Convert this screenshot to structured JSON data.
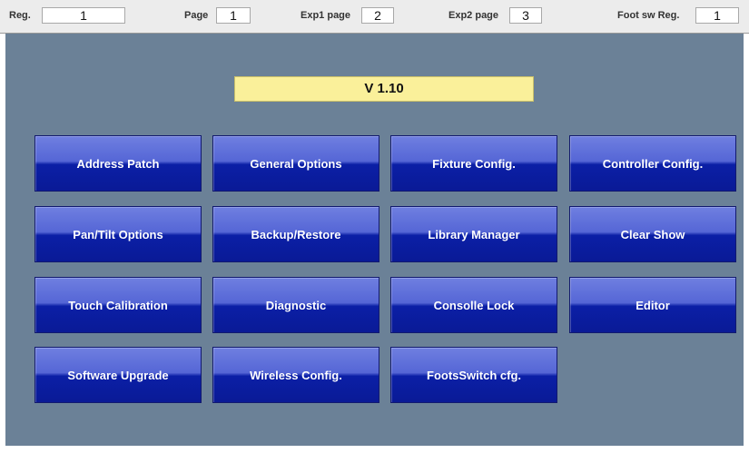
{
  "topbar": {
    "reg_label": "Reg.",
    "reg_value": "1",
    "page_label": "Page",
    "page_value": "1",
    "exp1_label": "Exp1 page",
    "exp1_value": "2",
    "exp2_label": "Exp2 page",
    "exp2_value": "3",
    "footsw_label": "Foot sw Reg.",
    "footsw_value": "1"
  },
  "version": "V 1.10",
  "buttons": [
    "Address Patch",
    "General Options",
    "Fixture Config.",
    "Controller Config.",
    "Pan/Tilt Options",
    "Backup/Restore",
    "Library Manager",
    "Clear Show",
    "Touch Calibration",
    "Diagnostic",
    "Consolle Lock",
    "Editor",
    "Software Upgrade",
    "Wireless Config.",
    "FootsSwitch cfg."
  ],
  "colors": {
    "background": "#6b8197",
    "button_top": "#6f7fe0",
    "button_bottom": "#0b1fa6",
    "version_bg": "#faf09a"
  }
}
